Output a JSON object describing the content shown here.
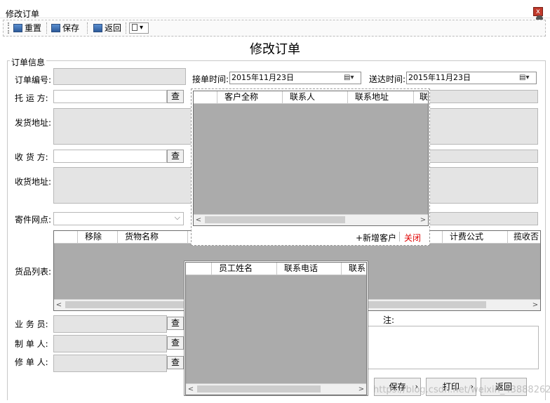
{
  "window": {
    "title": "修改订单",
    "close_label": "x"
  },
  "toolbar": {
    "reset_label": "重置",
    "save_label": "保存",
    "back_label": "返回"
  },
  "form": {
    "heading": "修改订单",
    "section_label": "订单信息",
    "order_no_label": "订单编号:",
    "receive_time_label": "接单时间:",
    "receive_time_value": "2015年11月23日",
    "deliver_time_label": "送达时间:",
    "deliver_time_value": "2015年11月23日",
    "shipper_label": "托 运 方:",
    "ship_addr_label": "发货地址:",
    "consignee_label": "收 货 方:",
    "recv_addr_label": "收货地址:",
    "outlet_label": "寄件网点:",
    "goods_label": "货品列表:",
    "salesman_label": "业 务 员:",
    "creator_label": "制 单 人:",
    "modifier_label": "修 单 人:",
    "remark_label": "注:",
    "query_label": "查"
  },
  "goods_grid": {
    "columns": [
      "移除",
      "货物名称",
      "",
      "计费公式",
      "揽收否"
    ]
  },
  "customer_popup": {
    "columns": [
      "客户全称",
      "联系人",
      "联系地址",
      "联"
    ],
    "add_label": "+新增客户",
    "close_label": "关闭"
  },
  "employee_popup": {
    "columns": [
      "员工姓名",
      "联系电话",
      "联系"
    ]
  },
  "bottom": {
    "save_label": "保存",
    "print_label": "打印",
    "back_label": "返回",
    "watermark": "https://blog.csdn.net/weixin_43888262"
  },
  "colors": {
    "grid_bg": "#ababab",
    "close_text": "#e00000",
    "title_bg": "#dfe8f5"
  }
}
